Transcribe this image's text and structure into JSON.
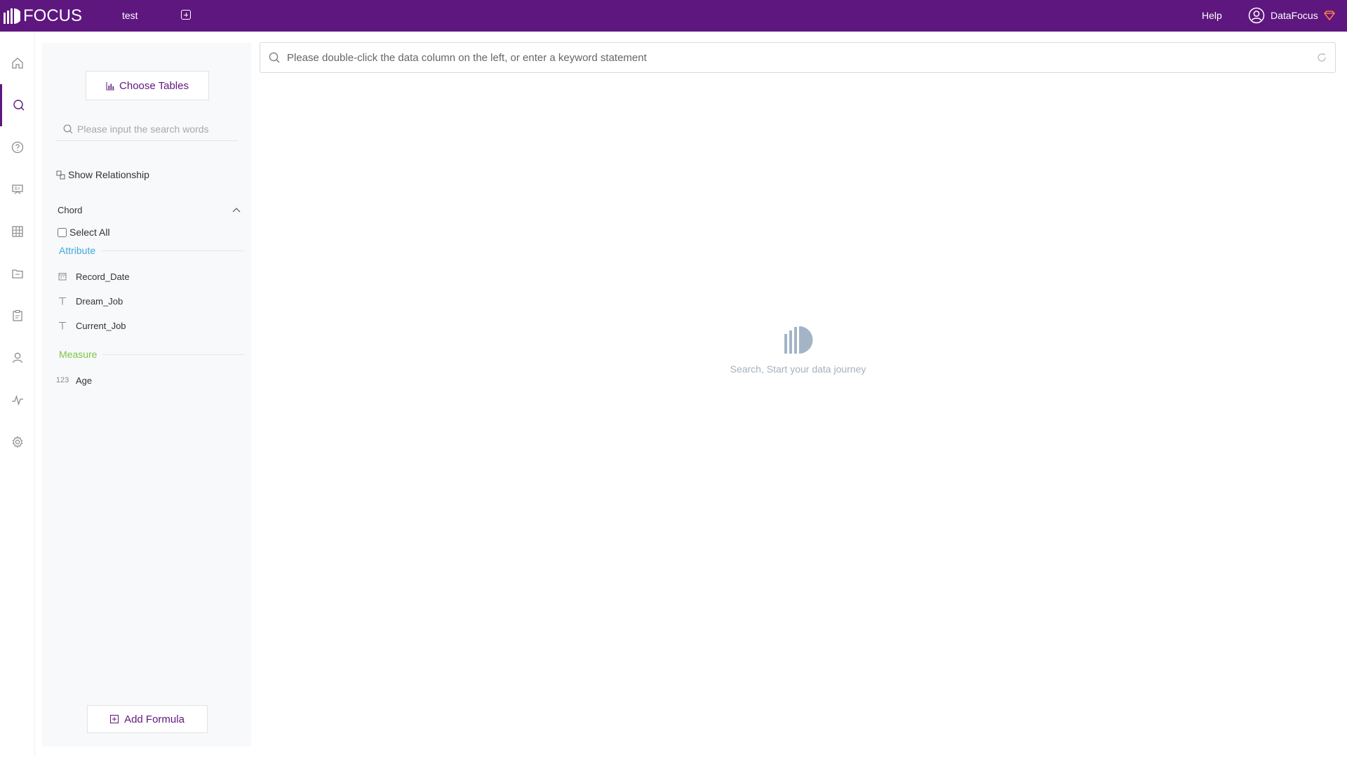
{
  "app": {
    "logo_text": "FOCUS",
    "tab_name": "test",
    "help_label": "Help",
    "user_name": "DataFocus",
    "accent_color": "#5e177f"
  },
  "rail": {
    "items": [
      {
        "name": "home-icon",
        "active": false
      },
      {
        "name": "search-icon",
        "active": true
      },
      {
        "name": "question-icon",
        "active": false
      },
      {
        "name": "presentation-icon",
        "active": false
      },
      {
        "name": "table-icon",
        "active": false
      },
      {
        "name": "folder-icon",
        "active": false
      },
      {
        "name": "clipboard-icon",
        "active": false
      },
      {
        "name": "user-icon",
        "active": false
      },
      {
        "name": "pulse-icon",
        "active": false
      },
      {
        "name": "gear-icon",
        "active": false
      }
    ]
  },
  "panel": {
    "choose_tables_label": "Choose Tables",
    "search_placeholder": "Please input the search words",
    "show_relationship_label": "Show Relationship",
    "table_name": "Chord",
    "select_all_label": "Select All",
    "attribute_label": "Attribute",
    "measure_label": "Measure",
    "attributes": [
      {
        "label": "Record_Date",
        "icon": "calendar-icon"
      },
      {
        "label": "Dream_Job",
        "icon": "text-icon"
      },
      {
        "label": "Current_Job",
        "icon": "text-icon"
      }
    ],
    "measures": [
      {
        "label": "Age",
        "icon": "number-icon",
        "glyph": "123"
      }
    ],
    "add_formula_label": "Add Formula"
  },
  "main": {
    "search_placeholder": "Please double-click the data column on the left, or enter a keyword statement",
    "empty_text": "Search, Start your data journey"
  }
}
